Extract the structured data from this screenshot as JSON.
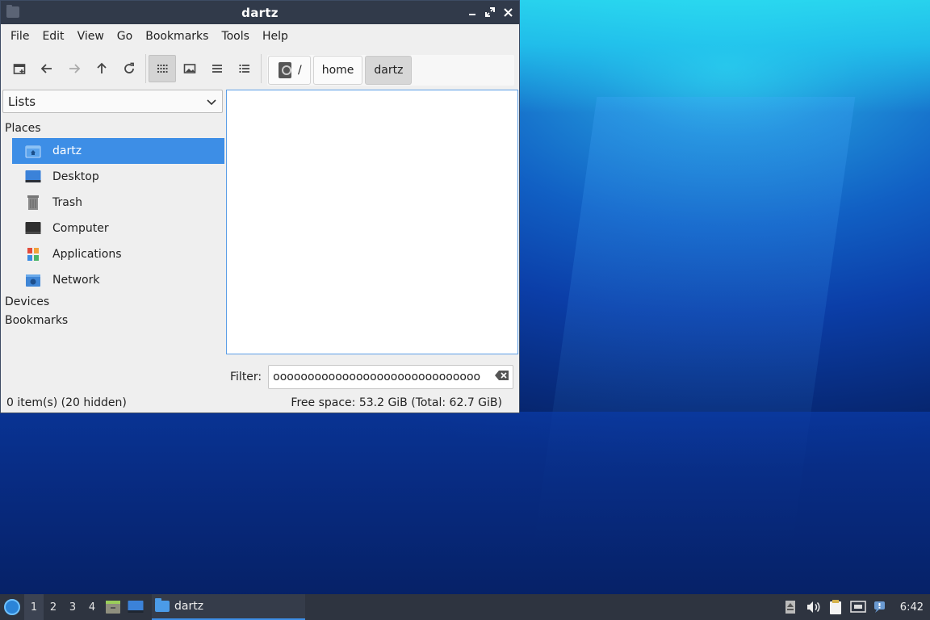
{
  "window": {
    "title": "dartz",
    "controls": {
      "minimize_icon": "minimize-icon",
      "maximize_icon": "restore-icon",
      "close_icon": "close-icon"
    }
  },
  "menubar": {
    "items": [
      "File",
      "Edit",
      "View",
      "Go",
      "Bookmarks",
      "Tools",
      "Help"
    ]
  },
  "toolbar": {
    "buttons": [
      "new-tab-icon",
      "back-arrow-icon",
      "forward-arrow-icon",
      "up-arrow-icon",
      "reload-icon",
      "icon-view-icon",
      "thumbnail-view-icon",
      "compact-view-icon",
      "detailed-list-view-icon"
    ]
  },
  "pathbar": {
    "root": "/",
    "crumbs": [
      "home",
      "dartz"
    ]
  },
  "sidepane": {
    "mode": "Lists",
    "sections": {
      "places": "Places",
      "devices": "Devices",
      "bookmarks": "Bookmarks"
    },
    "places": [
      {
        "label": "dartz",
        "icon": "home-folder-icon"
      },
      {
        "label": "Desktop",
        "icon": "desktop-icon"
      },
      {
        "label": "Trash",
        "icon": "trash-icon"
      },
      {
        "label": "Computer",
        "icon": "computer-icon"
      },
      {
        "label": "Applications",
        "icon": "applications-icon"
      },
      {
        "label": "Network",
        "icon": "network-icon"
      }
    ]
  },
  "filter": {
    "label": "Filter:",
    "value": "oooooooooooooooooooooooooooooo"
  },
  "status": {
    "items": "0 item(s) (20 hidden)",
    "free_space": "Free space: 53.2 GiB (Total: 62.7 GiB)"
  },
  "taskbar": {
    "workspaces": [
      "1",
      "2",
      "3",
      "4"
    ],
    "task": "dartz",
    "clock": "6:42"
  },
  "colors": {
    "accent": "#3d8ee6",
    "titlebar": "#313a4a",
    "taskbar": "#2e3440"
  }
}
